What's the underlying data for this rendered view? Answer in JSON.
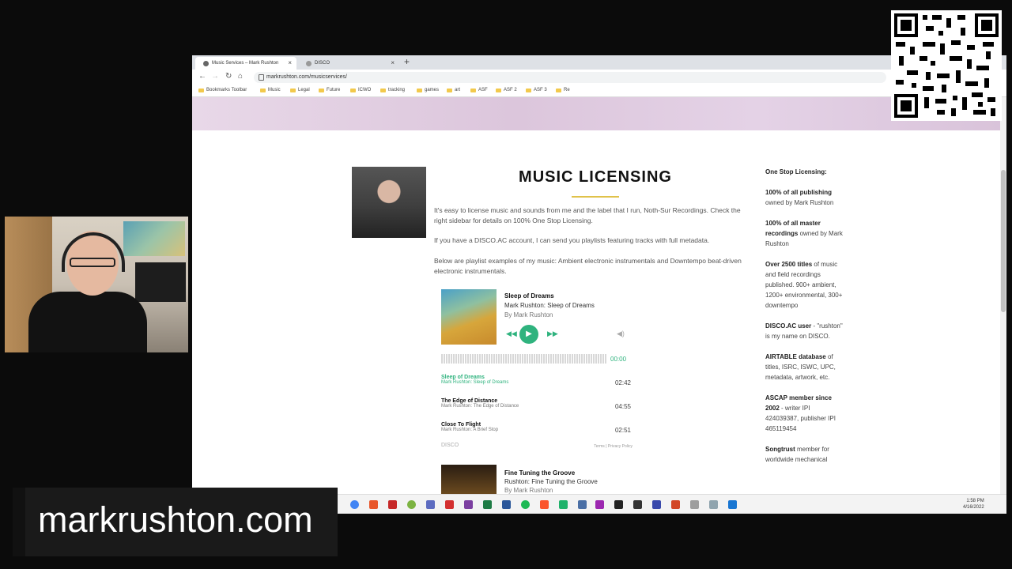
{
  "browser": {
    "tabs": [
      {
        "label": "Music Services – Mark Rushton",
        "active": true
      },
      {
        "label": "DISCO",
        "active": false
      }
    ],
    "url": "markrushton.com/musicservices/",
    "bookmarks": [
      "Bookmarks Toolbar",
      "Music",
      "Legal",
      "Future",
      "ICWO",
      "tracking",
      "games",
      "art",
      "ASF",
      "ASF 2",
      "ASF 3",
      "Re"
    ]
  },
  "page": {
    "title": "MUSIC LICENSING",
    "intro": "It's easy to license music and sounds from me and the label that I run, Noth-Sur Recordings.  Check the right sidebar for details on 100% One Stop Licensing.",
    "disco_para": "If you have a DISCO.AC account, I can send you playlists featuring tracks with full metadata.",
    "playlist_para": "Below are playlist examples of my music:  Ambient electronic instrumentals and Downtempo beat-driven electronic instrumentals."
  },
  "player1": {
    "title": "Sleep of Dreams",
    "subtitle": "Mark Rushton: Sleep of Dreams",
    "by": "By Mark Rushton",
    "time": "00:00",
    "tracks": [
      {
        "title": "Sleep of Dreams",
        "sub": "Mark Rushton: Sleep of Dreams",
        "dur": "02:42",
        "active": true
      },
      {
        "title": "The Edge of Distance",
        "sub": "Mark Rushton: The Edge of Distance",
        "dur": "04:55",
        "active": false
      },
      {
        "title": "Close To Flight",
        "sub": "Mark Rushton: A Brief Stop",
        "dur": "02:51",
        "active": false
      }
    ],
    "brand": "DISCO",
    "footer": "Terms | Privacy Policy"
  },
  "player2": {
    "title": "Fine Tuning the Groove",
    "subtitle": "Rushton: Fine Tuning the Groove",
    "by": "By Mark Rushton"
  },
  "sidebar": {
    "heading": "One Stop Licensing:",
    "p1_bold": "100% of all publishing",
    "p1_rest": " owned by Mark Rushton",
    "p2_bold": "100% of all master recordings",
    "p2_rest": " owned by Mark Rushton",
    "p3_bold": "Over 2500 titles",
    "p3_rest": " of music and field recordings published. 900+ ambient, 1200+ environmental, 300+ downtempo",
    "p4_bold": "DISCO.AC user",
    "p4_rest": " - \"rushton\" is my name on DISCO.",
    "p5_bold": "AIRTABLE database",
    "p5_rest": " of titles, ISRC, ISWC, UPC, metadata, artwork, etc.",
    "p6_bold": "ASCAP member since 2002",
    "p6_rest": " - writer IPI 424039387, publisher IPI 465119454",
    "p7_bold": "Songtrust",
    "p7_rest": " member for worldwide mechanical"
  },
  "taskbar": {
    "time": "1:58 PM",
    "date": "4/16/2022"
  },
  "caption": "markrushton.com",
  "colors": {
    "accent_green": "#2fb37e",
    "gold_line": "#e0c24a"
  }
}
